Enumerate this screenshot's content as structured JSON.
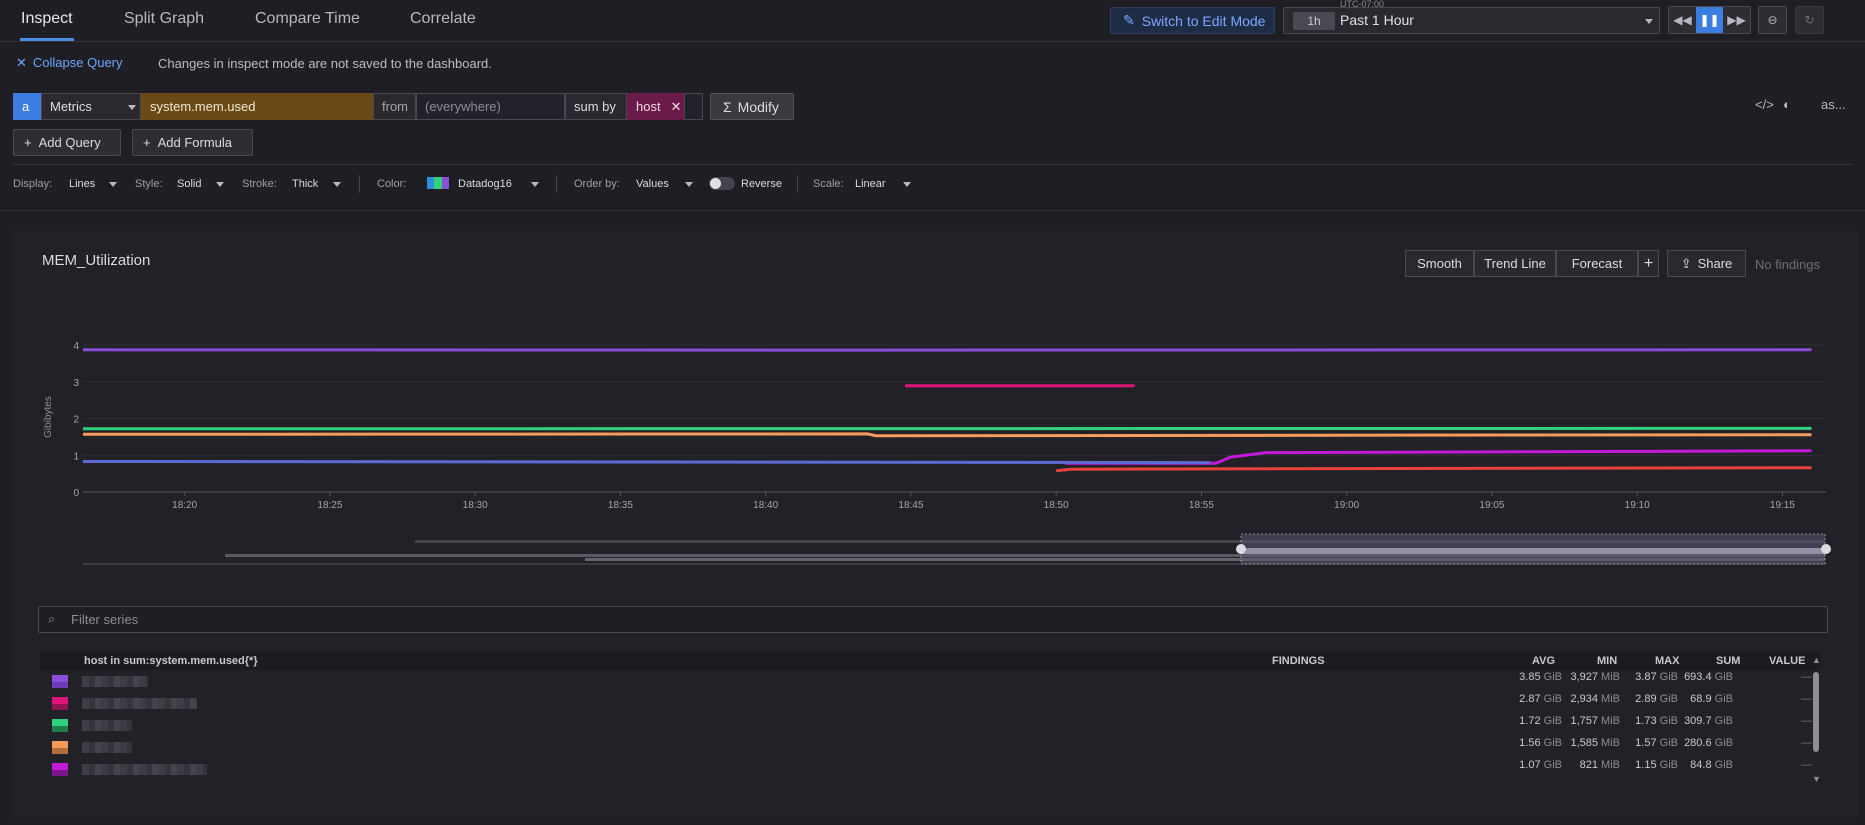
{
  "tabs": [
    "Inspect",
    "Split Graph",
    "Compare Time",
    "Correlate"
  ],
  "header": {
    "edit_mode_label": "Switch to Edit Mode",
    "timezone": "UTC-07:00",
    "time_badge": "1h",
    "time_range": "Past 1 Hour"
  },
  "query_bar": {
    "collapse_label": "Collapse Query",
    "notice": "Changes in inspect mode are not saved to the dashboard.",
    "query_id": "a",
    "source": "Metrics",
    "metric": "system.mem.used",
    "from_label": "from",
    "from_placeholder": "(everywhere)",
    "sum_by_label": "sum by",
    "group_tag": "host",
    "modify_label": "Modify",
    "as_label": "as...",
    "add_query_label": "Add Query",
    "add_formula_label": "Add Formula"
  },
  "display_options": {
    "display_label": "Display:",
    "display_value": "Lines",
    "style_label": "Style:",
    "style_value": "Solid",
    "stroke_label": "Stroke:",
    "stroke_value": "Thick",
    "color_label": "Color:",
    "color_value": "Datadog16",
    "order_label": "Order by:",
    "order_value": "Values",
    "reverse_label": "Reverse",
    "scale_label": "Scale:",
    "scale_value": "Linear"
  },
  "graph": {
    "title": "MEM_Utilization",
    "buttons": {
      "smooth": "Smooth",
      "trend": "Trend Line",
      "forecast": "Forecast",
      "add": "+",
      "share": "Share"
    },
    "no_findings": "No findings"
  },
  "chart_data": {
    "type": "line",
    "ylabel": "Gibibytes",
    "ylim": [
      0,
      4
    ],
    "yticks": [
      "0",
      "1",
      "2",
      "3",
      "4"
    ],
    "xticks": [
      "18:20",
      "18:25",
      "18:30",
      "18:35",
      "18:40",
      "18:45",
      "18:50",
      "18:55",
      "19:00",
      "19:05",
      "19:10",
      "19:15"
    ],
    "x_range_min": [
      16.5,
      76.5
    ],
    "series": [
      {
        "color": "#8a4fd8",
        "points": [
          [
            16.5,
            3.87
          ],
          [
            40,
            3.86
          ],
          [
            76,
            3.87
          ]
        ]
      },
      {
        "color": "#e0157a",
        "points": [
          [
            44.8,
            2.89
          ],
          [
            52.7,
            2.89
          ]
        ]
      },
      {
        "color": "#2fd27a",
        "points": [
          [
            16.5,
            1.72
          ],
          [
            76,
            1.73
          ]
        ]
      },
      {
        "color": "#f59a5a",
        "points": [
          [
            16.5,
            1.57
          ],
          [
            43.5,
            1.58
          ],
          [
            43.8,
            1.53
          ],
          [
            76,
            1.56
          ]
        ]
      },
      {
        "color": "#c21ad6",
        "points": [
          [
            50.3,
            0.78
          ],
          [
            55.5,
            0.78
          ],
          [
            56,
            0.95
          ],
          [
            57.2,
            1.07
          ],
          [
            76,
            1.12
          ]
        ]
      },
      {
        "color": "#5e6ad6",
        "points": [
          [
            16.5,
            0.83
          ],
          [
            55.3,
            0.8
          ]
        ]
      },
      {
        "color": "#e8433a",
        "points": [
          [
            50,
            0.58
          ],
          [
            50.5,
            0.62
          ],
          [
            76,
            0.66
          ]
        ]
      }
    ]
  },
  "table": {
    "filter_placeholder": "Filter series",
    "columns": {
      "name": "host in sum:system.mem.used{*}",
      "findings": "FINDINGS",
      "avg": "AVG",
      "min": "MIN",
      "max": "MAX",
      "sum": "SUM",
      "value": "VALUE"
    },
    "rows": [
      {
        "color_a": "#8a4fd8",
        "color_b": "#6d3bb8",
        "avg": "3.85",
        "avg_u": "GiB",
        "min": "3,927",
        "min_u": "MiB",
        "max": "3.87",
        "max_u": "GiB",
        "sum": "693.4",
        "sum_u": "GiB",
        "value": "—"
      },
      {
        "color_a": "#e0157a",
        "color_b": "#8f1350",
        "avg": "2.87",
        "avg_u": "GiB",
        "min": "2,934",
        "min_u": "MiB",
        "max": "2.89",
        "max_u": "GiB",
        "sum": "68.9",
        "sum_u": "GiB",
        "value": "—"
      },
      {
        "color_a": "#2fd27a",
        "color_b": "#1e7f4c",
        "avg": "1.72",
        "avg_u": "GiB",
        "min": "1,757",
        "min_u": "MiB",
        "max": "1.73",
        "max_u": "GiB",
        "sum": "309.7",
        "sum_u": "GiB",
        "value": "—"
      },
      {
        "color_a": "#f59a5a",
        "color_b": "#b56a3a",
        "avg": "1.56",
        "avg_u": "GiB",
        "min": "1,585",
        "min_u": "MiB",
        "max": "1.57",
        "max_u": "GiB",
        "sum": "280.6",
        "sum_u": "GiB",
        "value": "—"
      },
      {
        "color_a": "#c21ad6",
        "color_b": "#7d1590",
        "avg": "1.07",
        "avg_u": "GiB",
        "min": "821",
        "min_u": "MiB",
        "max": "1.15",
        "max_u": "GiB",
        "sum": "84.8",
        "sum_u": "GiB",
        "value": "—"
      }
    ]
  },
  "colors": {
    "accent": "#3b7de0",
    "background": "#1f1e24",
    "panel": "#222128"
  }
}
